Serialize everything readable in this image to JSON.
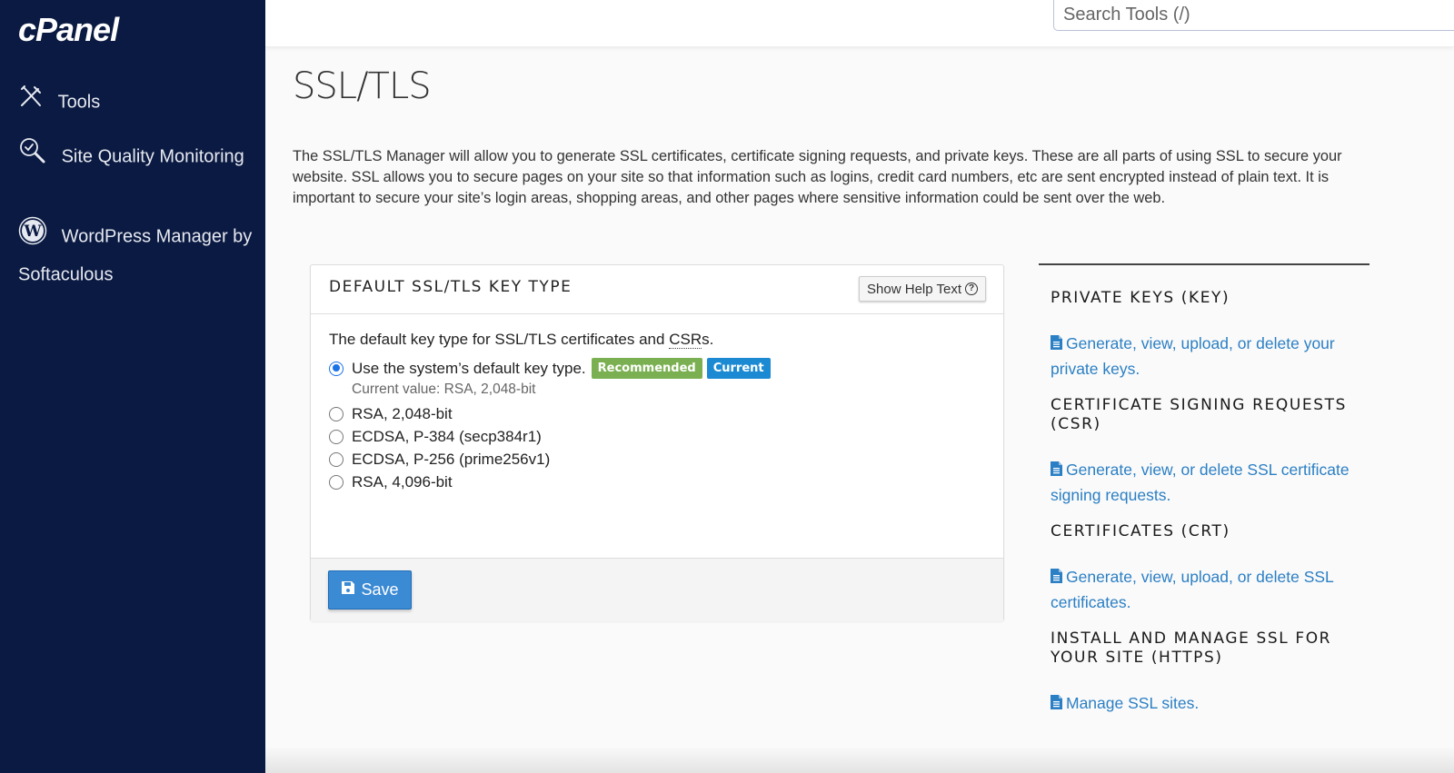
{
  "app": {
    "logo_text": "cPanel"
  },
  "sidebar": {
    "items": [
      {
        "label": "Tools",
        "icon": "tools-icon"
      },
      {
        "label": "Site Quality Monitoring",
        "icon": "magnifier-check-icon"
      },
      {
        "label": "WordPress Manager by Softaculous",
        "icon": "wordpress-icon"
      }
    ]
  },
  "header": {
    "search_placeholder": "Search Tools (/)"
  },
  "page": {
    "title": "SSL/TLS",
    "description": "The SSL/TLS Manager will allow you to generate SSL certificates, certificate signing requests, and private keys. These are all parts of using SSL to secure your website. SSL allows you to secure pages on your site so that information such as logins, credit card numbers, etc are sent encrypted instead of plain text. It is important to secure your site’s login areas, shopping areas, and other pages where sensitive information could be sent over the web."
  },
  "key_type_panel": {
    "title": "DEFAULT SSL/TLS KEY TYPE",
    "help_button": "Show Help Text",
    "intro_prefix": "The default key type for SSL/TLS certificates and ",
    "intro_abbr": "CSR",
    "intro_suffix": "s.",
    "options": [
      {
        "label": "Use the system’s default key type.",
        "checked": true
      },
      {
        "label": "RSA, 2,048-bit",
        "checked": false
      },
      {
        "label": "ECDSA, P-384 (secp384r1)",
        "checked": false
      },
      {
        "label": "ECDSA, P-256 (prime256v1)",
        "checked": false
      },
      {
        "label": "RSA, 4,096-bit",
        "checked": false
      }
    ],
    "badges": {
      "recommended": "Recommended",
      "current": "Current"
    },
    "current_value": "Current value: RSA, 2,048-bit",
    "save_label": "Save"
  },
  "right_sections": [
    {
      "title": "PRIVATE KEYS (KEY)",
      "link": "Generate, view, upload, or delete your private keys."
    },
    {
      "title": "CERTIFICATE SIGNING REQUESTS (CSR)",
      "link": "Generate, view, or delete SSL certificate signing requests."
    },
    {
      "title": "CERTIFICATES (CRT)",
      "link": "Generate, view, upload, or delete SSL certificates."
    },
    {
      "title": "INSTALL AND MANAGE SSL FOR YOUR SITE (HTTPS)",
      "link": "Manage SSL sites."
    }
  ],
  "colors": {
    "sidebar_bg": "#0b1a42",
    "link": "#2b7fc4",
    "save_button": "#3b8ad4",
    "badge_recommended": "#7ab051",
    "badge_current": "#1b8ad3",
    "radio_checked": "#1a73e8"
  }
}
